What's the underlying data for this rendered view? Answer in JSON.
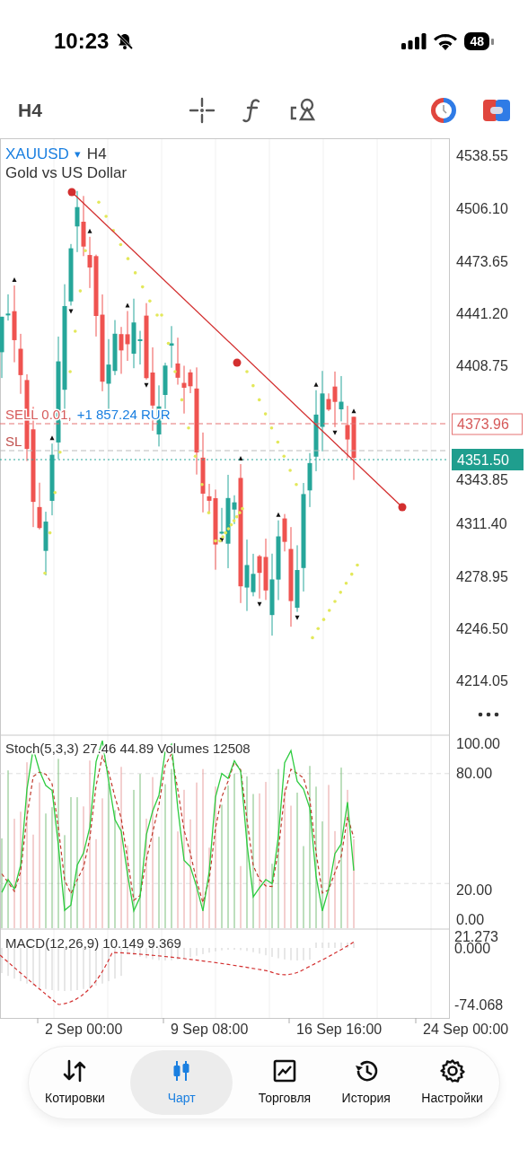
{
  "status_bar": {
    "time": "10:23",
    "battery": "48"
  },
  "toolbar": {
    "timeframe": "H4"
  },
  "chart": {
    "symbol": "XAUUSD",
    "symbol_arrow": "▾",
    "timeframe": "H4",
    "description": "Gold vs US Dollar",
    "price_axis": [
      "4538.55",
      "4506.10",
      "4473.65",
      "4441.20",
      "4408.75",
      "4343.85",
      "4311.40",
      "4278.95",
      "4246.50",
      "4214.05"
    ],
    "order": {
      "side": "SELL 0.01,",
      "profit": "+1 857.24 RUR",
      "price": "4373.96"
    },
    "stop_loss": {
      "label": "SL"
    },
    "current_price": "4351.50"
  },
  "stochastic": {
    "legend": "Stoch(5,3,3) 27.46 44.89 Volumes 12508",
    "axis": [
      "100.00",
      "80.00",
      "20.00",
      "0.00"
    ]
  },
  "macd": {
    "legend": "MACD(12,26,9) 10.149 9.369",
    "axis": [
      "21.273",
      "0.000",
      "-74.068"
    ]
  },
  "time_axis": [
    "2 Sep 00:00",
    "9 Sep 08:00",
    "16 Sep 16:00",
    "24 Sep 00:00"
  ],
  "nav": [
    {
      "kind": "quotes",
      "label": "Котировки",
      "selected": false
    },
    {
      "kind": "chart",
      "label": "Чарт",
      "selected": true
    },
    {
      "kind": "trade",
      "label": "Торговля",
      "selected": false
    },
    {
      "kind": "history",
      "label": "История",
      "selected": false
    },
    {
      "kind": "settings",
      "label": "Настройки",
      "selected": false
    }
  ]
}
